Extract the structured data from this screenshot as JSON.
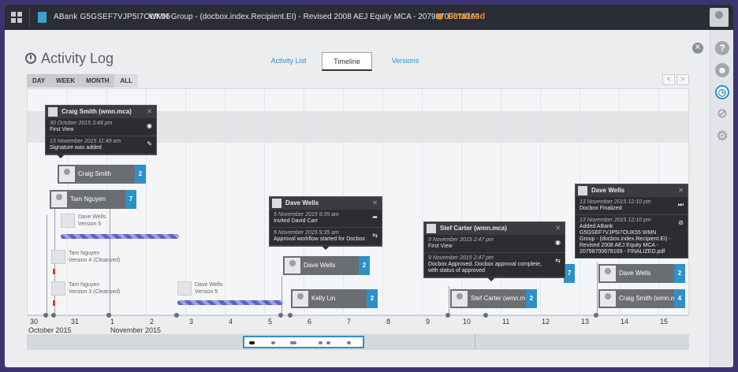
{
  "topbar": {
    "account": "ABank G5GSEF7VJP5I7OUK55",
    "document": "WMN Group - (docbox.index.Recipient.EI) - Revised 2008 AEJ Equity MCA - 20798700678169",
    "status": "Finalized"
  },
  "page": {
    "title": "Activity Log",
    "tabs": [
      "Activity List",
      "Timeline",
      "Versions"
    ],
    "active_tab": "Timeline",
    "range_buttons": [
      "DAY",
      "WEEK",
      "MONTH",
      "ALL"
    ],
    "selected_range": "ALL",
    "pager": [
      "<",
      ">"
    ]
  },
  "rail_icons": [
    "help-icon",
    "people-icon",
    "history-icon",
    "attachment-icon",
    "settings-icon"
  ],
  "axis": {
    "ticks": [
      "30",
      "31",
      "1",
      "2",
      "3",
      "4",
      "5",
      "6",
      "7",
      "8",
      "9",
      "10",
      "11",
      "12",
      "13",
      "14",
      "15"
    ],
    "months": [
      "October 2015",
      "November 2015"
    ]
  },
  "cards": {
    "craig1": {
      "name": "Craig Smith",
      "count": "2"
    },
    "tam": {
      "name": "Tam Nguyen",
      "count": "7"
    },
    "dave_mid": {
      "name": "Dave Wells",
      "count": "2"
    },
    "kelly": {
      "name": "Kelly Lin",
      "count": "2"
    },
    "stef": {
      "name": "Stef Carter (wmn.m...",
      "count": "2"
    },
    "stef_count": {
      "count": "7"
    },
    "dave_right": {
      "name": "Dave Wells",
      "count": "2"
    },
    "craig2": {
      "name": "Craig Smith (wmn.m...",
      "count": "4"
    }
  },
  "versions": {
    "v1": {
      "name": "Dave Wells",
      "label": "Version 5"
    },
    "v2": {
      "name": "Tam Nguyen",
      "label": "Version 4 (Cleansed)"
    },
    "v3": {
      "name": "Tam Nguyen",
      "label": "Version 3 (Cleansed)"
    },
    "v4": {
      "name": "Dave Wells",
      "label": "Version 5"
    }
  },
  "popups": {
    "p1": {
      "title": "Craig Smith (wmn.mca)",
      "rows": [
        {
          "date": "30 October 2015 3:48 pm",
          "text": "First View"
        },
        {
          "date": "13 November 2015 11:49 am",
          "text": "Signature was added"
        }
      ]
    },
    "p2": {
      "title": "Dave Wells",
      "rows": [
        {
          "date": "5 November 2015 9:35 am",
          "text": "Invited David Carr"
        },
        {
          "date": "5 November 2015 9:35 am",
          "text": "Approval workflow started for Docbox"
        }
      ]
    },
    "p3": {
      "title": "Stef Carter (wmn.mca)",
      "rows": [
        {
          "date": "9 November 2015 2:47 pm",
          "text": "First View"
        },
        {
          "date": "9 November 2015 2:47 pm",
          "text": "Docbox Approved. Docbox approval complete, with status of approved"
        }
      ]
    },
    "p4": {
      "title": "Dave Wells",
      "rows": [
        {
          "date": "13 November 2015 12:10 pm",
          "text": "Docbox Finalized"
        },
        {
          "date": "13 November 2015 12:10 pm",
          "text": "Added ABank G5GSEF7VJP5I7OUK55 WMN Group - (docbox.index.Recipient.EI) - Revised 2008 AEJ Equity MCA - 20798700678169 - FINALIZED.pdf"
        }
      ]
    }
  },
  "colors": {
    "accent": "#2f90c8",
    "status": "#f08a24",
    "card": "#6a6d72",
    "popup": "#2b2d33"
  }
}
